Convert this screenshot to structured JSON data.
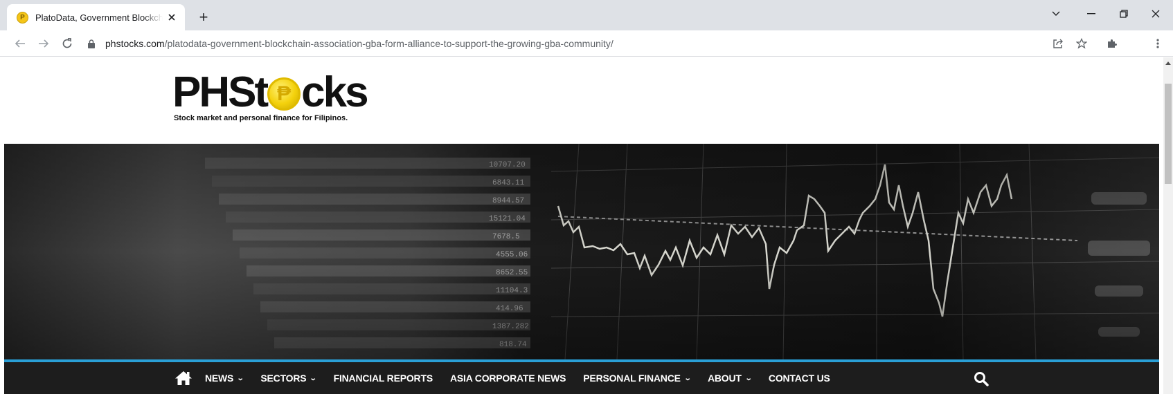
{
  "browser": {
    "tab": {
      "title": "PlatoData, Government Blockchain Association (GBA) Form Alliance",
      "favicon_glyph": "P",
      "close_glyph": "✕"
    },
    "new_tab_glyph": "+",
    "url": {
      "host": "phstocks.com",
      "path": "/platodata-government-blockchain-association-gba-form-alliance-to-support-the-growing-gba-community/"
    },
    "icons": [
      "back-icon",
      "forward-icon",
      "reload-icon",
      "lock-icon",
      "share-icon",
      "star-icon",
      "extensions-icon",
      "menu-icon",
      "chevron-down-icon",
      "minimize-icon",
      "restore-icon",
      "close-icon"
    ]
  },
  "site": {
    "logo": {
      "prefix": "PHSt",
      "coin_glyph": "₱",
      "suffix": "cks",
      "tagline": "Stock market and personal finance for Filipinos."
    },
    "nav": [
      {
        "label": "NEWS",
        "dropdown": true
      },
      {
        "label": "SECTORS",
        "dropdown": true
      },
      {
        "label": "FINANCIAL REPORTS",
        "dropdown": false
      },
      {
        "label": "ASIA CORPORATE NEWS",
        "dropdown": false
      },
      {
        "label": "PERSONAL FINANCE",
        "dropdown": true
      },
      {
        "label": "ABOUT",
        "dropdown": true
      },
      {
        "label": "CONTACT US",
        "dropdown": false
      }
    ],
    "colors": {
      "accent_line": "#2a9fd6",
      "menubar_bg": "#1d1d1d",
      "coin": "#f4d10c"
    }
  }
}
